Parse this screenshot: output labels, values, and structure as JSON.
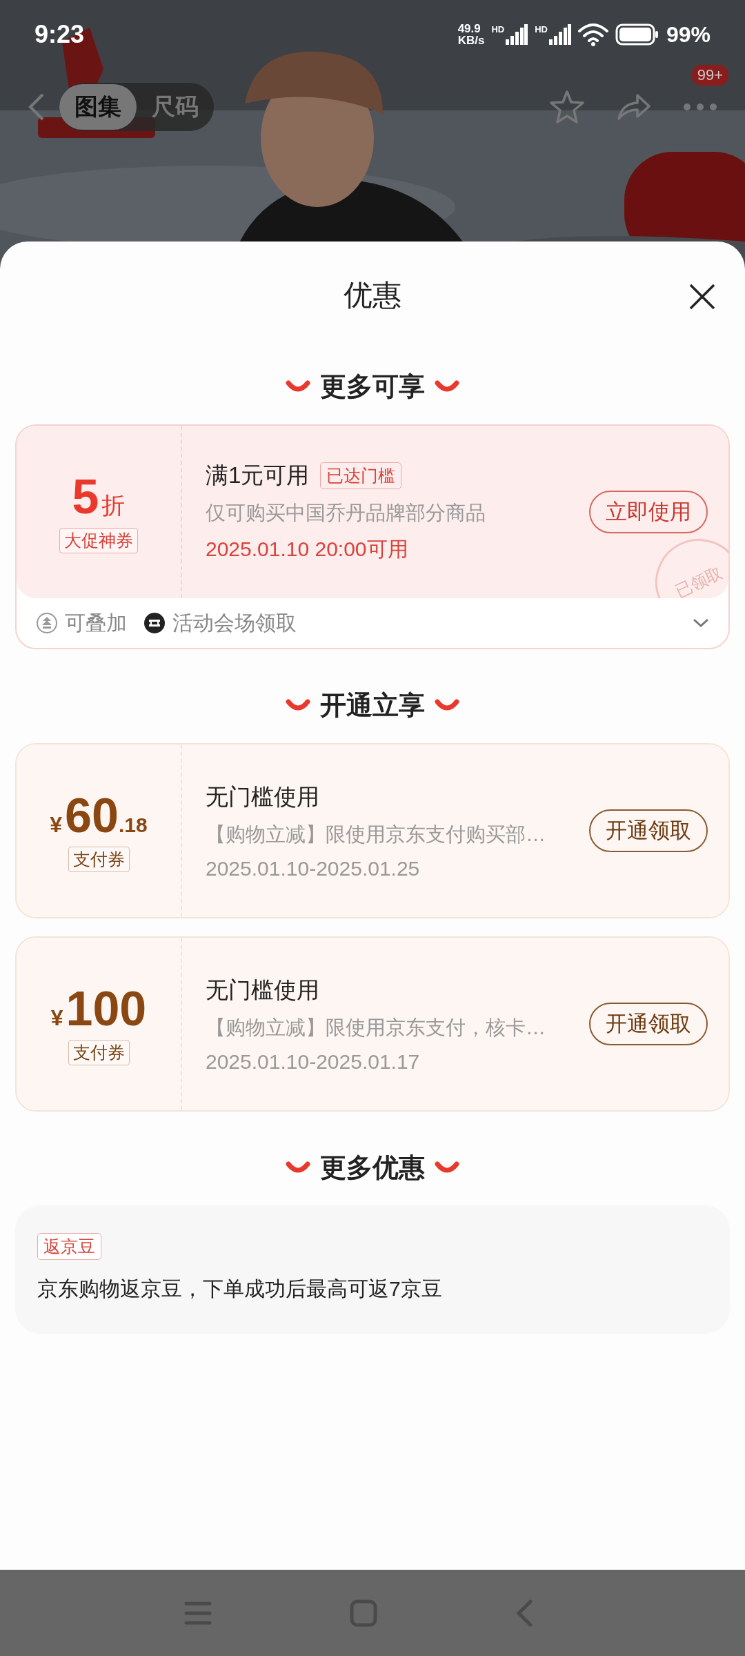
{
  "status_bar": {
    "time": "9:23",
    "speed_value": "49.9",
    "speed_unit": "KB/s",
    "signals": [
      {
        "label": "HD"
      },
      {
        "label": "HD"
      }
    ],
    "battery": "99%"
  },
  "header": {
    "tabs": [
      {
        "label": "图集",
        "selected": true
      },
      {
        "label": "尺码",
        "selected": false
      }
    ],
    "more_badge": "99+"
  },
  "sheet": {
    "title": "优惠",
    "sections": [
      {
        "heading": "更多可享",
        "kind": "coupons",
        "coupons": [
          {
            "kind": "promo",
            "value": "5",
            "unit": "折",
            "tag": "大促神券",
            "title": "满1元可用",
            "badge": "已达门槛",
            "description": "仅可购买中国乔丹品牌部分商品",
            "date": "2025.01.10 20:00可用",
            "button": "立即使用",
            "stamp": "已领取",
            "features": [
              {
                "kind": "stack",
                "text": "可叠加"
              },
              {
                "kind": "ticket",
                "text": "活动会场领取"
              }
            ]
          }
        ]
      },
      {
        "heading": "开通立享",
        "kind": "coupons",
        "coupons": [
          {
            "kind": "pay",
            "currency": "¥",
            "value": "60",
            "decimal": ".18",
            "tag": "支付券",
            "title": "无门槛使用",
            "description": "【购物立减】限使用京东支付购买部…",
            "date": "2025.01.10-2025.01.25",
            "button": "开通领取"
          },
          {
            "kind": "pay",
            "currency": "¥",
            "value": "100",
            "tag": "支付券",
            "title": "无门槛使用",
            "description": "【购物立减】限使用京东支付，核卡…",
            "date": "2025.01.10-2025.01.17",
            "button": "开通领取"
          }
        ]
      },
      {
        "heading": "更多优惠",
        "kind": "perks",
        "perks": [
          {
            "tag": "返京豆",
            "text": "京东购物返京豆，下单成功后最高可返7京豆"
          }
        ]
      }
    ]
  }
}
